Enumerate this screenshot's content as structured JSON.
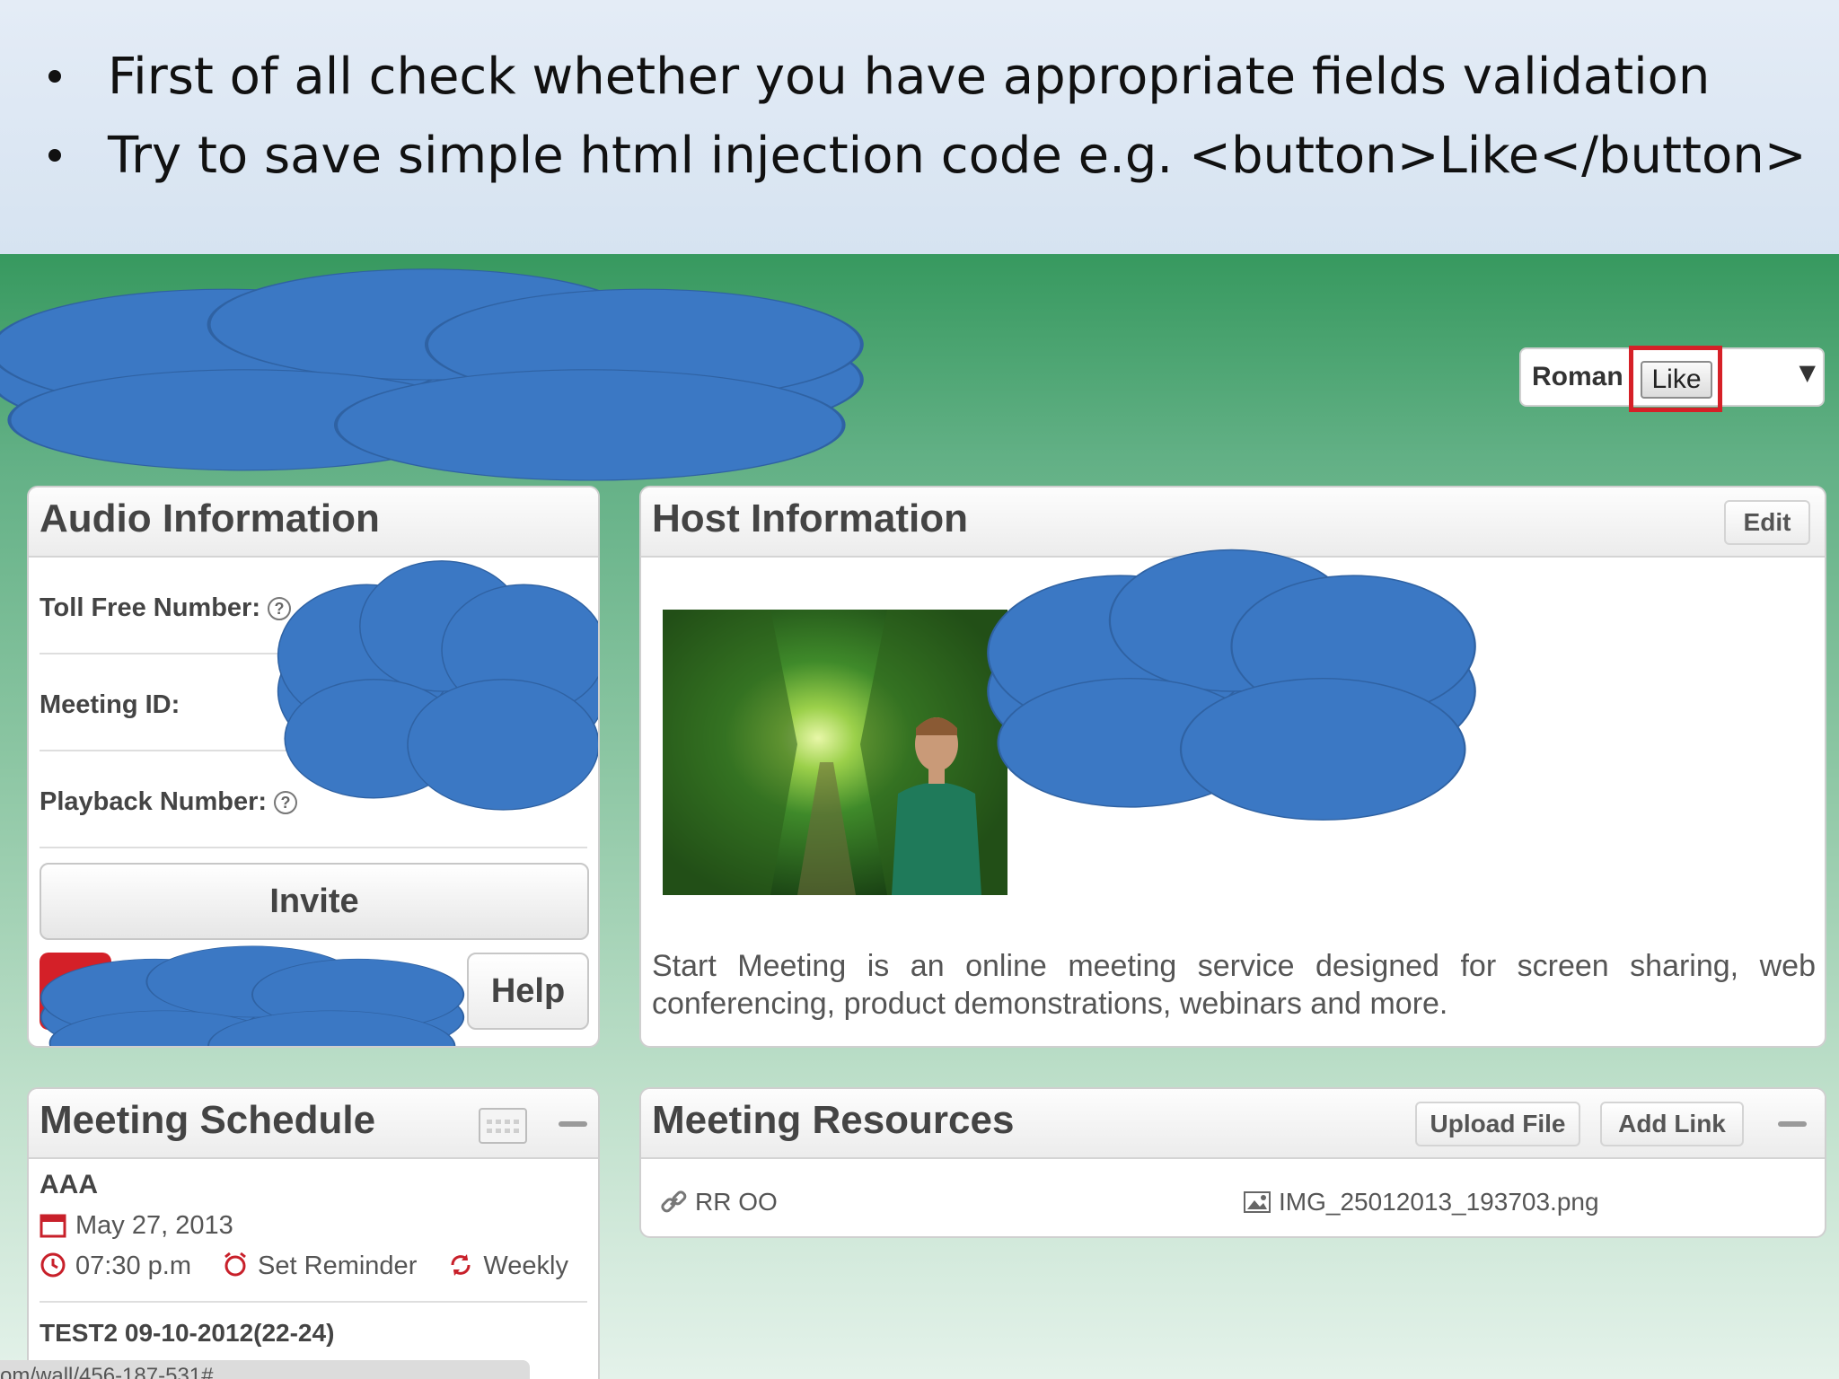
{
  "slide": {
    "bullets": [
      "First of all check whether you have appropriate fields validation",
      "Try to save simple html injection code e.g.  <button>Like</button>"
    ]
  },
  "user_menu": {
    "name": "Roman",
    "injected_button_label": "Like",
    "dropdown_icon": "caret-down-icon"
  },
  "audio_panel": {
    "title": "Audio Information",
    "fields": [
      {
        "label": "Toll Free Number:"
      },
      {
        "label": "Meeting ID:"
      },
      {
        "label": "Playback Number:"
      }
    ],
    "help_icon_glyph": "?",
    "invite_label": "Invite",
    "help_label": "Help"
  },
  "host_panel": {
    "title": "Host Information",
    "edit_label": "Edit",
    "description": "Start Meeting is an online meeting service designed for screen sharing, web conferencing, product demonstrations, webinars and more."
  },
  "schedule_panel": {
    "title": "Meeting Schedule",
    "meetings": [
      {
        "name": "AAA",
        "date": "May 27, 2013",
        "time": "07:30 p.m",
        "reminder": "Set Reminder",
        "recurrence": "Weekly"
      },
      {
        "name": "TEST2 09-10-2012(22-24)"
      }
    ],
    "status_url": "om/wall/456-187-531#"
  },
  "resources_panel": {
    "title": "Meeting Resources",
    "upload_label": "Upload File",
    "add_link_label": "Add Link",
    "items": [
      {
        "label": "RR OO",
        "icon": "link-icon"
      },
      {
        "label": "IMG_25012013_193703.png",
        "icon": "image-file-icon"
      }
    ]
  },
  "colors": {
    "highlight_red": "#d62027",
    "redaction_blue": "#3b78c4",
    "app_green": "#37995f"
  }
}
